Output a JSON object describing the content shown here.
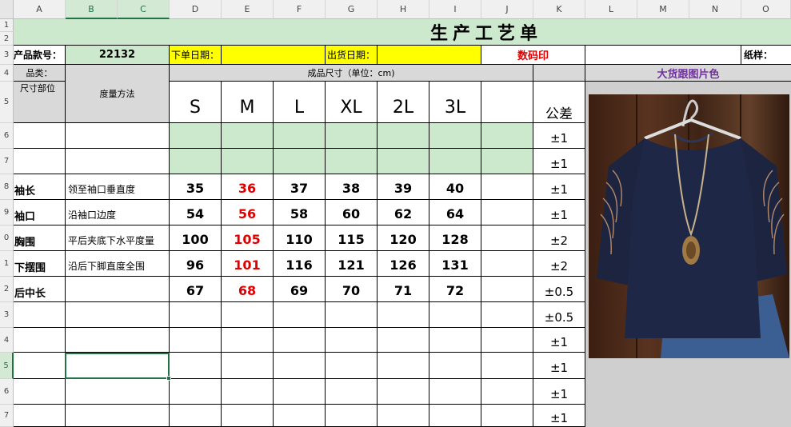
{
  "columns": [
    "A",
    "B",
    "C",
    "D",
    "E",
    "F",
    "G",
    "H",
    "I",
    "J",
    "K",
    "L",
    "M",
    "N",
    "O"
  ],
  "rows": [
    "1",
    "2",
    "3",
    "4",
    "5",
    "6",
    "7",
    "8",
    "9",
    "0",
    "1",
    "2",
    "3",
    "4",
    "5",
    "6",
    "7"
  ],
  "title": "生产工艺单",
  "info": {
    "product_no_label": "产品款号：",
    "product_no": "22132",
    "order_date_label": "下单日期：",
    "order_date": "",
    "ship_date_label": "出货日期：",
    "ship_date": "",
    "print_type": "数码印",
    "paper_label": "纸样："
  },
  "category_label": "品类：",
  "part_label": "尺寸部位",
  "method_label": "度量方法",
  "size_header": "成品尺寸（单位：cm)",
  "photo_header": "大货跟图片色",
  "tolerance_header": "公差",
  "sizes": [
    "S",
    "M",
    "L",
    "XL",
    "2L",
    "3L"
  ],
  "blank_tolerances": [
    "±1",
    "±1"
  ],
  "measurements": [
    {
      "part": "袖长",
      "method": "领至袖口垂直度",
      "values": [
        "35",
        "36",
        "37",
        "38",
        "39",
        "40"
      ],
      "tol": "±1"
    },
    {
      "part": "袖口",
      "method": "沿袖口边度",
      "values": [
        "54",
        "56",
        "58",
        "60",
        "62",
        "64"
      ],
      "tol": "±1"
    },
    {
      "part": "胸围",
      "method": "平后夹底下水平度量",
      "values": [
        "100",
        "105",
        "110",
        "115",
        "120",
        "128"
      ],
      "tol": "±2"
    },
    {
      "part": "下摆围",
      "method": "沿后下脚直度全围",
      "values": [
        "96",
        "101",
        "116",
        "121",
        "126",
        "131"
      ],
      "tol": "±2"
    },
    {
      "part": "后中长",
      "method": "",
      "values": [
        "67",
        "68",
        "69",
        "70",
        "71",
        "72"
      ],
      "tol": "±0.5"
    }
  ],
  "extra_tolerances": [
    "±0.5",
    "±1",
    "±1",
    "±1",
    "±1"
  ],
  "colors": {
    "green": "#cde9cd",
    "yellow": "#ffff00",
    "gray": "#d9d9d9",
    "red": "#e00000",
    "purple": "#7030a0"
  }
}
